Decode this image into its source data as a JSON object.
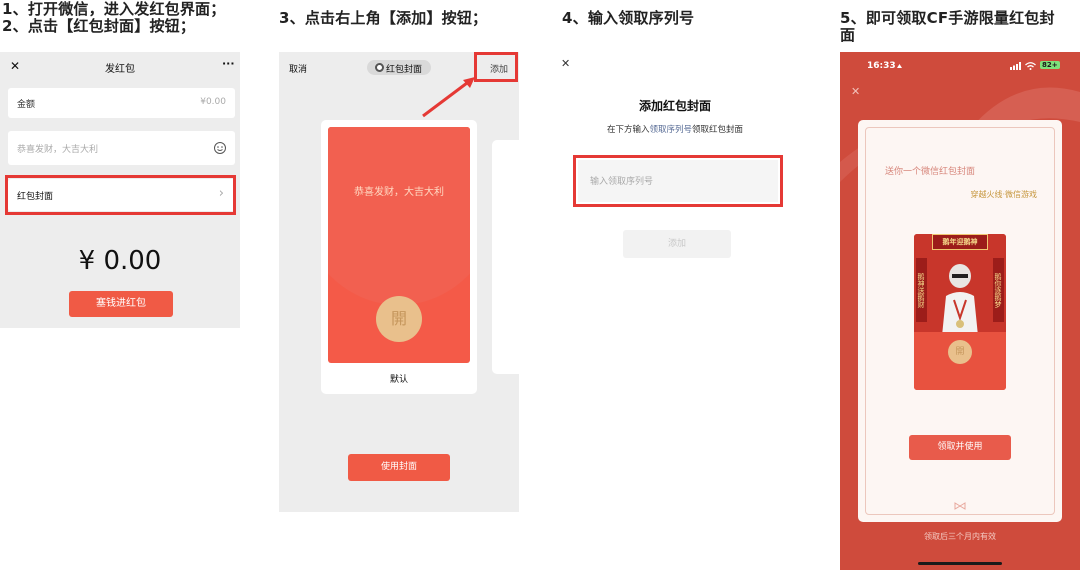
{
  "steps": {
    "s1_line1": "1、打开微信，进入发红包界面；",
    "s1_line2": "2、点击【红包封面】按钮；",
    "s3": "3、点击右上角【添加】按钮；",
    "s4": "4、输入领取序列号",
    "s5_line1": "5、即可领取CF手游限量红包封",
    "s5_line2": "面"
  },
  "panel1": {
    "close": "✕",
    "title": "发红包",
    "more": "···",
    "amount_label": "金额",
    "amount_value": "¥0.00",
    "greeting_placeholder": "恭喜发财，大吉大利",
    "cover_label": "红包封面",
    "cover_chevron": "›",
    "total": "¥ 0.00",
    "stuff_button": "塞钱进红包"
  },
  "panel2": {
    "cancel": "取消",
    "title": "红包封面",
    "add": "添加",
    "envelope_text": "恭喜发财，大吉大利",
    "open_char": "開",
    "default_label": "默认",
    "use_button": "使用封面"
  },
  "panel3": {
    "close": "✕",
    "title": "添加红包封面",
    "subtitle_pre": "在下方输入",
    "subtitle_link": "领取序列号",
    "subtitle_post": "领取红包封面",
    "input_placeholder": "输入领取序列号",
    "add_button": "添加"
  },
  "panel4": {
    "time": "16:33",
    "battery": "82+",
    "close": "✕",
    "gift_text": "送你一个微信红包封面",
    "source_text": "穿越火线·微信游戏",
    "envelope_banner": "鹅年迎鹅神",
    "left_couplet": "鹅神送鹅财",
    "right_couplet": "鹅你逐鹅梦",
    "open_char": "開",
    "claim_button": "领取并使用",
    "validity": "领取后三个月内有效"
  },
  "colors": {
    "accent_red": "#f05a45",
    "highlight_red": "#e53935",
    "panel_bg": "#ededed",
    "link_blue": "#576b95",
    "gold": "#e9c08c"
  }
}
